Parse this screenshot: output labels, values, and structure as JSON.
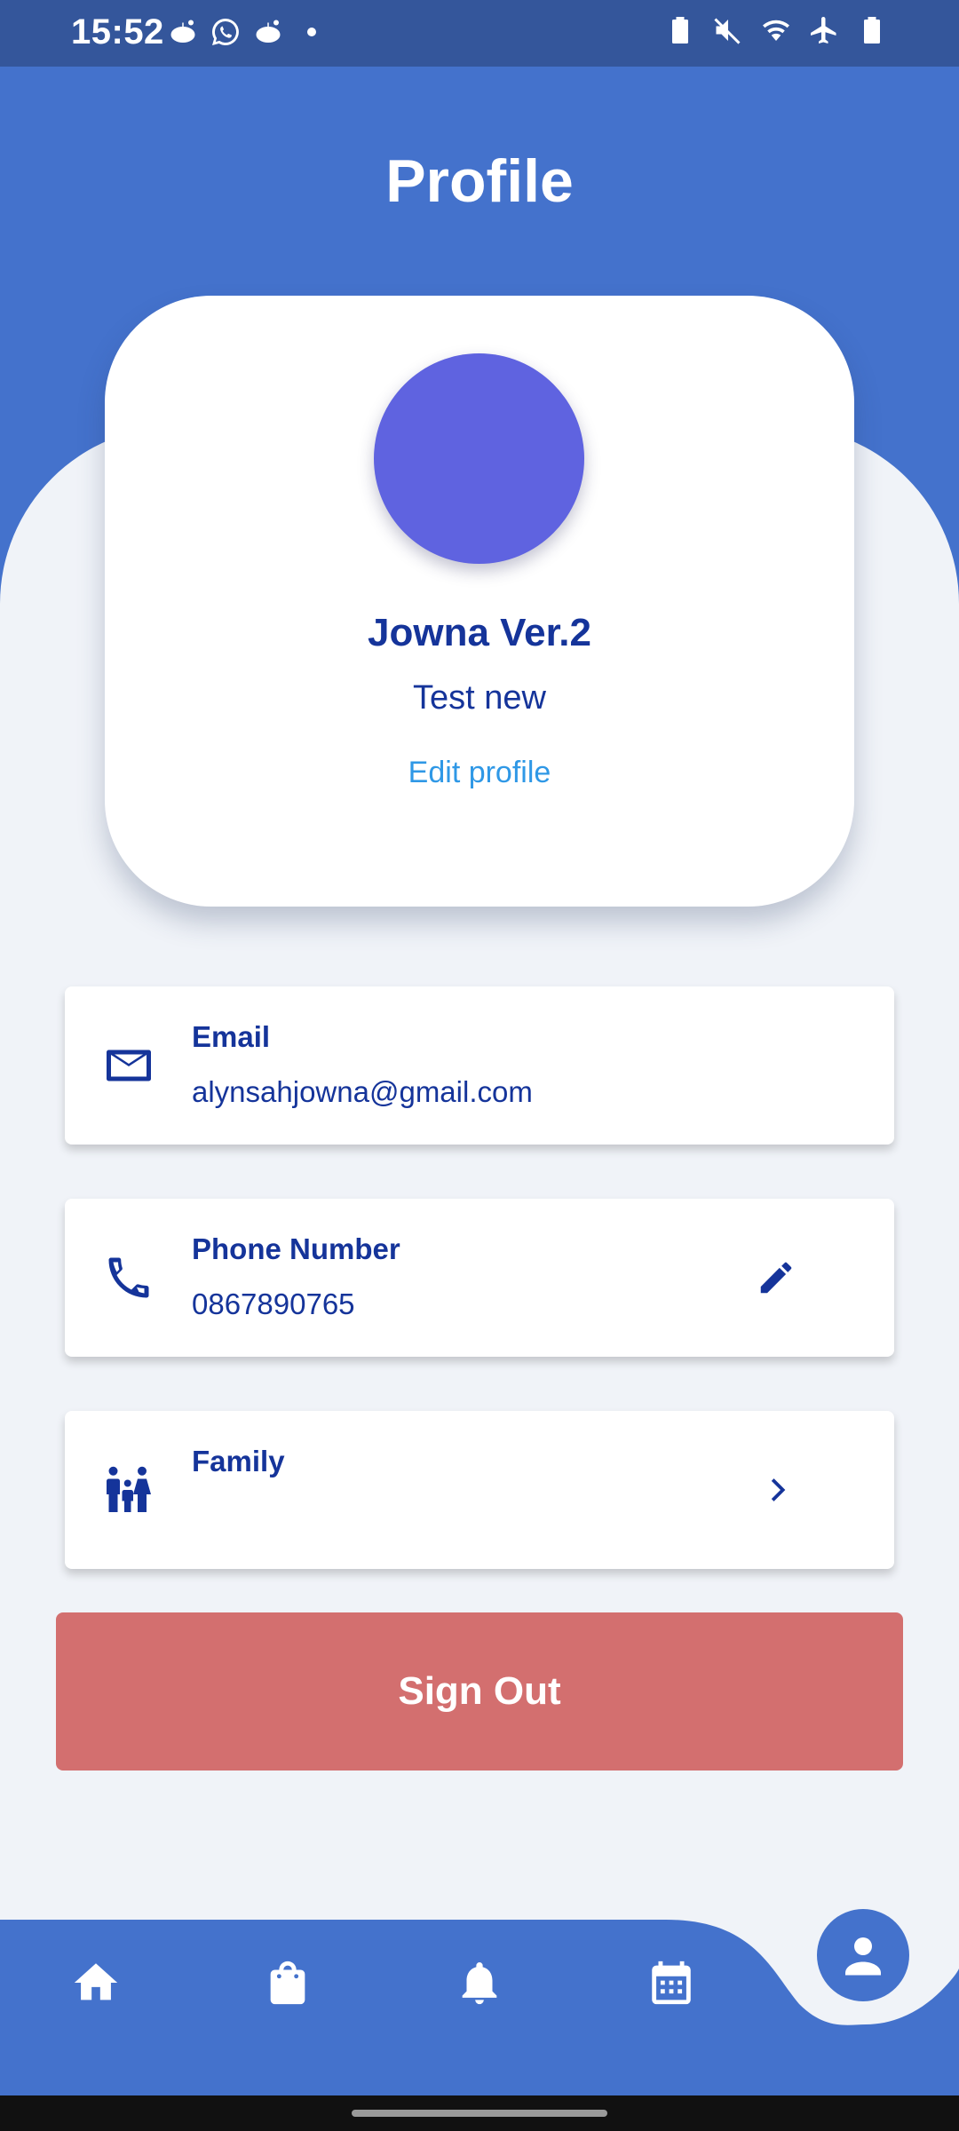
{
  "status_bar": {
    "time": "15:52",
    "left_icons": [
      "reddit-icon",
      "whatsapp-icon",
      "reddit-icon"
    ],
    "right_icons": [
      "battery-saver-icon",
      "mute-icon",
      "wifi-icon",
      "airplane-icon",
      "battery-icon"
    ]
  },
  "header": {
    "title": "Profile"
  },
  "profile": {
    "name": "Jowna Ver.2",
    "subtitle": "Test new",
    "edit_label": "Edit profile",
    "avatar_color": "#5f63e0"
  },
  "info_cards": [
    {
      "label": "Email",
      "value": "alynsahjowna@gmail.com",
      "icon": "mail-icon"
    },
    {
      "label": "Phone Number",
      "value": "0867890765",
      "icon": "phone-icon",
      "action_icon": "edit-icon"
    },
    {
      "label": "Family",
      "value": "",
      "icon": "family-icon",
      "action_icon": "chevron-right-icon"
    }
  ],
  "sign_out": {
    "label": "Sign Out",
    "color": "#d36f6f"
  },
  "bottom_nav": {
    "items": [
      "home-icon",
      "shopping-bag-icon",
      "bell-icon",
      "calendar-icon",
      "profile-icon"
    ],
    "active": "profile-icon"
  },
  "colors": {
    "primary": "#4472cc",
    "status_bar": "#34569b",
    "text_dark": "#15349a",
    "link": "#2f98e6",
    "background": "#f0f3f8"
  }
}
